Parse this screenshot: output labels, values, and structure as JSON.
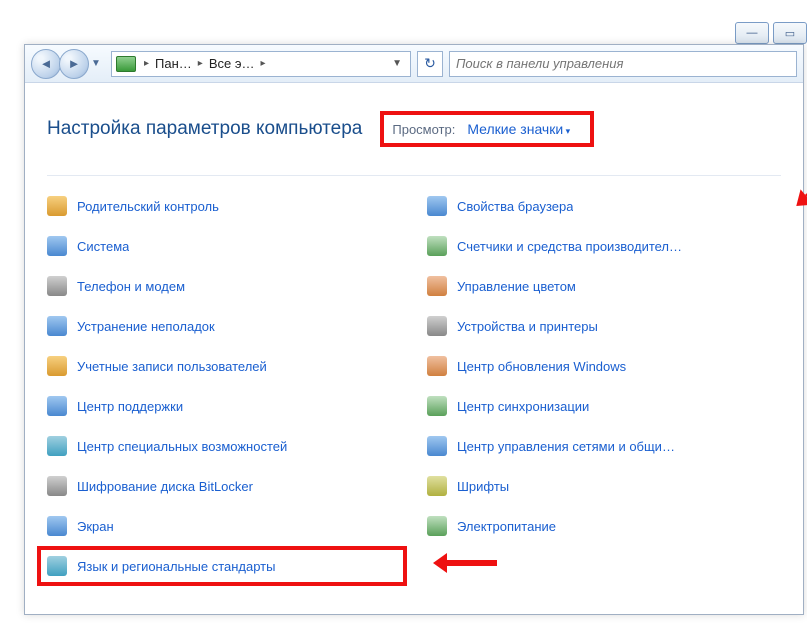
{
  "titlebar": {
    "min": "—",
    "max": "▭"
  },
  "toolbar": {
    "crumb1": "Пан…",
    "crumb2": "Все э…",
    "search_placeholder": "Поиск в панели управления"
  },
  "header": {
    "title": "Настройка параметров компьютера",
    "view_label": "Просмотр:",
    "view_value": "Мелкие значки"
  },
  "items_left": [
    {
      "label": "Родительский контроль",
      "ico": "ic-a"
    },
    {
      "label": "Система",
      "ico": "ic-b"
    },
    {
      "label": "Телефон и модем",
      "ico": "ic-c"
    },
    {
      "label": "Устранение неполадок",
      "ico": "ic-b"
    },
    {
      "label": "Учетные записи пользователей",
      "ico": "ic-a"
    },
    {
      "label": "Центр поддержки",
      "ico": "ic-b"
    },
    {
      "label": "Центр специальных возможностей",
      "ico": "ic-g"
    },
    {
      "label": "Шифрование диска BitLocker",
      "ico": "ic-c"
    },
    {
      "label": "Экран",
      "ico": "ic-b"
    },
    {
      "label": "Язык и региональные стандарты",
      "ico": "ic-g",
      "highlight": true
    }
  ],
  "items_right": [
    {
      "label": "Свойства браузера",
      "ico": "ic-b"
    },
    {
      "label": "Счетчики и средства производител…",
      "ico": "ic-d"
    },
    {
      "label": "Управление цветом",
      "ico": "ic-h"
    },
    {
      "label": "Устройства и принтеры",
      "ico": "ic-c"
    },
    {
      "label": "Центр обновления Windows",
      "ico": "ic-h"
    },
    {
      "label": "Центр синхронизации",
      "ico": "ic-d"
    },
    {
      "label": "Центр управления сетями и общи…",
      "ico": "ic-b"
    },
    {
      "label": "Шрифты",
      "ico": "ic-f"
    },
    {
      "label": "Электропитание",
      "ico": "ic-d"
    }
  ]
}
